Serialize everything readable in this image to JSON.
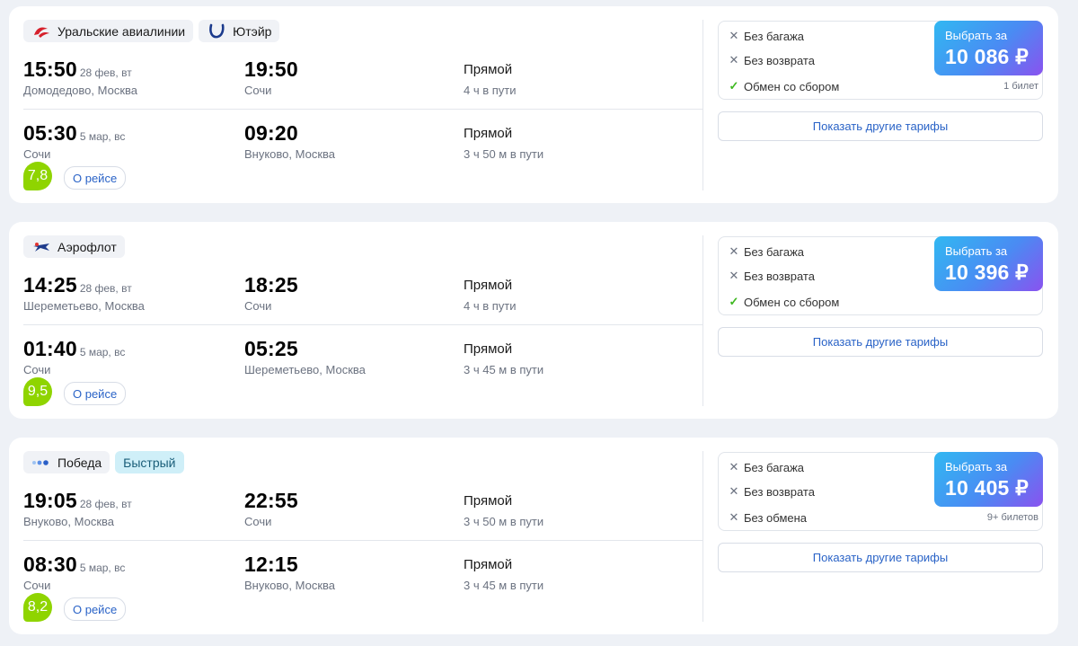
{
  "currency_sign": "₽",
  "colors": {
    "accent": "#2a63c7",
    "rating": "#8fd400",
    "ok": "#3eb820"
  },
  "cards": [
    {
      "airlines": [
        {
          "name": "Уральские авиалинии",
          "icon": "ural-airlines-logo"
        },
        {
          "name": "Ютэйр",
          "icon": "utair-logo"
        }
      ],
      "outbound": {
        "dep_time": "15:50",
        "dep_date": "28 фев, вт",
        "dep_place": "Домодедово, Москва",
        "arr_time": "19:50",
        "arr_place": "Сочи",
        "type": "Прямой",
        "duration": "4 ч в пути"
      },
      "inbound": {
        "dep_time": "05:30",
        "dep_date": "5 мар, вс",
        "dep_place": "Сочи",
        "arr_time": "09:20",
        "arr_place": "Внуково, Москва",
        "type": "Прямой",
        "duration": "3 ч 50 м в пути"
      },
      "rating": "7,8",
      "about_label": "О рейсе",
      "features": [
        {
          "icon": "x",
          "text": "Без багажа"
        },
        {
          "icon": "x",
          "text": "Без возврата"
        },
        {
          "icon": "check",
          "text": "Обмен со сбором"
        }
      ],
      "buy_label": "Выбрать за",
      "price": "10 086",
      "tickets": "1 билет",
      "more_label": "Показать другие тарифы"
    },
    {
      "airlines": [
        {
          "name": "Аэрофлот",
          "icon": "aeroflot-logo"
        }
      ],
      "outbound": {
        "dep_time": "14:25",
        "dep_date": "28 фев, вт",
        "dep_place": "Шереметьево, Москва",
        "arr_time": "18:25",
        "arr_place": "Сочи",
        "type": "Прямой",
        "duration": "4 ч в пути"
      },
      "inbound": {
        "dep_time": "01:40",
        "dep_date": "5 мар, вс",
        "dep_place": "Сочи",
        "arr_time": "05:25",
        "arr_place": "Шереметьево, Москва",
        "type": "Прямой",
        "duration": "3 ч 45 м в пути"
      },
      "rating": "9,5",
      "about_label": "О рейсе",
      "features": [
        {
          "icon": "x",
          "text": "Без багажа"
        },
        {
          "icon": "x",
          "text": "Без возврата"
        },
        {
          "icon": "check",
          "text": "Обмен со сбором"
        }
      ],
      "buy_label": "Выбрать за",
      "price": "10 396",
      "tickets": "",
      "more_label": "Показать другие тарифы"
    },
    {
      "airlines": [
        {
          "name": "Победа",
          "icon": "pobeda-logo"
        }
      ],
      "badge": "Быстрый",
      "outbound": {
        "dep_time": "19:05",
        "dep_date": "28 фев, вт",
        "dep_place": "Внуково, Москва",
        "arr_time": "22:55",
        "arr_place": "Сочи",
        "type": "Прямой",
        "duration": "3 ч 50 м в пути"
      },
      "inbound": {
        "dep_time": "08:30",
        "dep_date": "5 мар, вс",
        "dep_place": "Сочи",
        "arr_time": "12:15",
        "arr_place": "Внуково, Москва",
        "type": "Прямой",
        "duration": "3 ч 45 м в пути"
      },
      "rating": "8,2",
      "about_label": "О рейсе",
      "features": [
        {
          "icon": "x",
          "text": "Без багажа"
        },
        {
          "icon": "x",
          "text": "Без возврата"
        },
        {
          "icon": "x",
          "text": "Без обмена"
        }
      ],
      "buy_label": "Выбрать за",
      "price": "10 405",
      "tickets": "9+ билетов",
      "more_label": "Показать другие тарифы"
    }
  ]
}
